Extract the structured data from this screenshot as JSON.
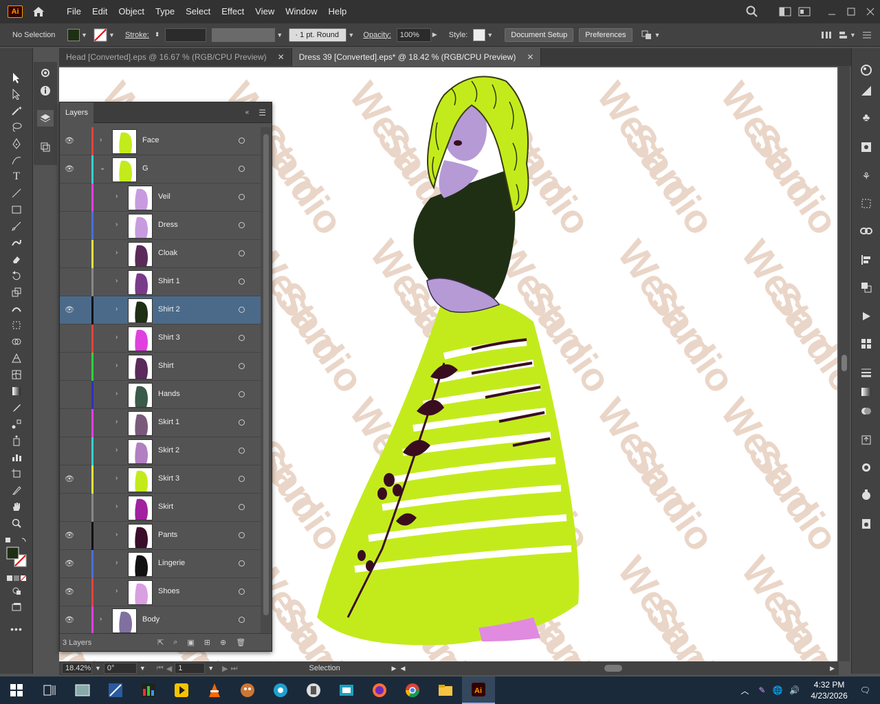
{
  "app": {
    "logo": "Ai"
  },
  "menu": [
    "File",
    "Edit",
    "Object",
    "Type",
    "Select",
    "Effect",
    "View",
    "Window",
    "Help"
  ],
  "control": {
    "selection": "No Selection",
    "stroke_label": "Stroke:",
    "brush": "1 pt. Round",
    "opacity_label": "Opacity:",
    "opacity": "100%",
    "style_label": "Style:",
    "doc_setup": "Document Setup",
    "preferences": "Preferences"
  },
  "tabs": [
    {
      "label": "Head [Converted].eps @ 16.67 % (RGB/CPU Preview)"
    },
    {
      "label": "Dress 39 [Converted].eps* @ 18.42 % (RGB/CPU Preview)"
    }
  ],
  "layers_panel": {
    "title": "Layers",
    "footer": "3 Layers",
    "rows": [
      {
        "name": "Face",
        "color": "#e0443a",
        "visible": true,
        "indent": 0,
        "selected": false
      },
      {
        "name": "G",
        "color": "#35d0d0",
        "visible": true,
        "indent": 0,
        "selected": false
      },
      {
        "name": "Veil",
        "color": "#e040e0",
        "visible": false,
        "indent": 1,
        "selected": false
      },
      {
        "name": "Dress",
        "color": "#4a6ee0",
        "visible": false,
        "indent": 1,
        "selected": false
      },
      {
        "name": "Cloak",
        "color": "#f0e040",
        "visible": false,
        "indent": 1,
        "selected": false
      },
      {
        "name": "Shirt 1",
        "color": "#888888",
        "visible": false,
        "indent": 1,
        "selected": false
      },
      {
        "name": "Shirt 2",
        "color": "#111111",
        "visible": true,
        "indent": 1,
        "selected": true
      },
      {
        "name": "Shirt 3",
        "color": "#e0443a",
        "visible": false,
        "indent": 1,
        "selected": false
      },
      {
        "name": "Shirt",
        "color": "#30d040",
        "visible": false,
        "indent": 1,
        "selected": false
      },
      {
        "name": "Hands",
        "color": "#3030c0",
        "visible": false,
        "indent": 1,
        "selected": false
      },
      {
        "name": "Skirt 1",
        "color": "#e040e0",
        "visible": false,
        "indent": 1,
        "selected": false
      },
      {
        "name": "Skirt 2",
        "color": "#35d0d0",
        "visible": false,
        "indent": 1,
        "selected": false
      },
      {
        "name": "Skirt 3",
        "color": "#f0e040",
        "visible": true,
        "indent": 1,
        "selected": false
      },
      {
        "name": "Skirt",
        "color": "#888888",
        "visible": false,
        "indent": 1,
        "selected": false
      },
      {
        "name": "Pants",
        "color": "#111111",
        "visible": true,
        "indent": 1,
        "selected": false
      },
      {
        "name": "Lingerie",
        "color": "#4a6ee0",
        "visible": true,
        "indent": 1,
        "selected": false
      },
      {
        "name": "Shoes",
        "color": "#e0443a",
        "visible": true,
        "indent": 1,
        "selected": false
      },
      {
        "name": "Body",
        "color": "#e040e0",
        "visible": true,
        "indent": 0,
        "selected": false
      }
    ]
  },
  "status": {
    "zoom": "18.42%",
    "rotation": "0°",
    "artboard": "1",
    "tool": "Selection"
  },
  "taskbar": {
    "time": "4:32 PM",
    "date": "4/23/2026"
  },
  "watermark": "Wesam Studio",
  "colors": {
    "accent": "#ff9a00",
    "skirt": "#c3eb1c",
    "shirt": "#1f2f14",
    "skin": "#b59ad6"
  }
}
